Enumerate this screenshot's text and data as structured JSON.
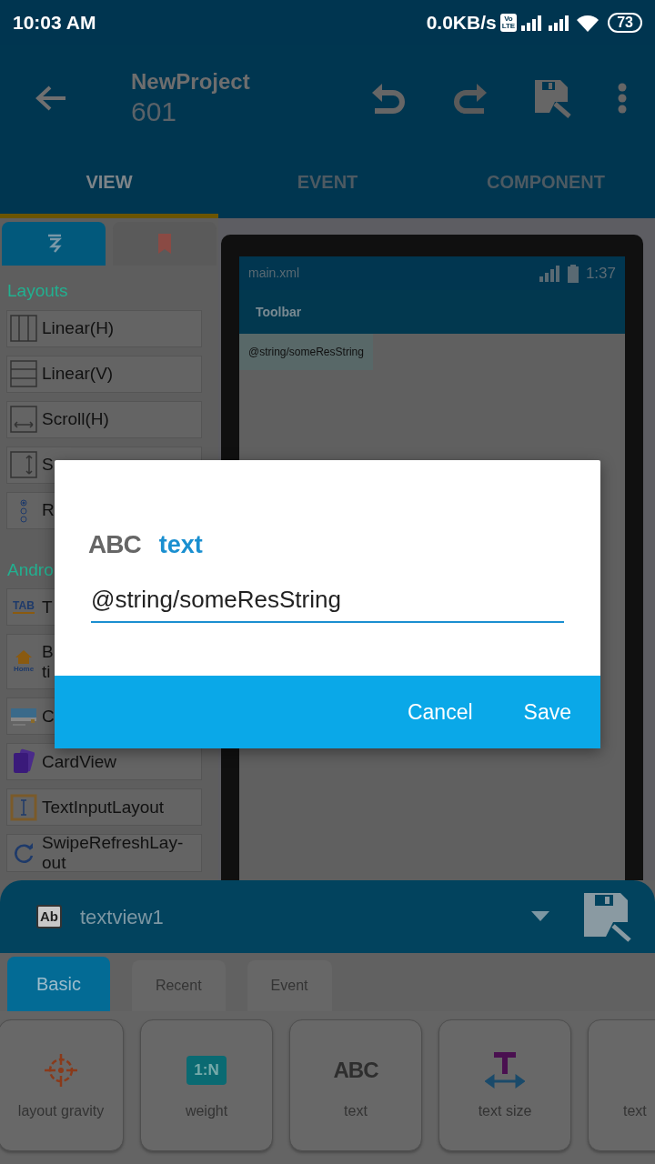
{
  "status_bar": {
    "time": "10:03 AM",
    "net_speed": "0.0KB/s",
    "volte_top": "Vo",
    "volte_bottom": "LTE",
    "battery": "73"
  },
  "app_bar": {
    "title": "NewProject",
    "subtitle": "601"
  },
  "tabs": [
    {
      "label": "VIEW",
      "selected": true
    },
    {
      "label": "EVENT",
      "selected": false
    },
    {
      "label": "COMPONENT",
      "selected": false
    }
  ],
  "palette": {
    "tabs": [
      {
        "selected": true
      },
      {
        "selected": false
      }
    ],
    "sections": [
      {
        "title": "Layouts",
        "items": [
          {
            "label": "Linear(H)"
          },
          {
            "label": "Linear(V)"
          },
          {
            "label": "Scroll(H)"
          },
          {
            "label": "S"
          },
          {
            "label": "R"
          }
        ]
      },
      {
        "title": "Andro",
        "items": [
          {
            "label": "T",
            "icon_text": "TAB"
          },
          {
            "label": "B ti",
            "icon_text": "Home"
          },
          {
            "label": "C"
          },
          {
            "label": "CardView"
          },
          {
            "label": "TextInputLayout"
          },
          {
            "label": "SwipeRefreshLay-out"
          }
        ]
      }
    ]
  },
  "preview": {
    "file": "main.xml",
    "time": "1:37",
    "toolbar": "Toolbar",
    "textview": "@string/someResString"
  },
  "bottom_sheet": {
    "widget_icon": "Ab",
    "widget": "textview1",
    "tabs": [
      {
        "label": "Basic",
        "selected": true
      },
      {
        "label": "Recent",
        "selected": false
      },
      {
        "label": "Event",
        "selected": false
      }
    ],
    "properties": [
      {
        "label": "layout gravity"
      },
      {
        "label": "weight",
        "icon_text": "1:N"
      },
      {
        "label": "text",
        "icon_text": "ABC"
      },
      {
        "label": "text size"
      },
      {
        "label": "text"
      }
    ]
  },
  "dialog": {
    "icon_text": "ABC",
    "title": "text",
    "value": "@string/someResString",
    "buttons": [
      "Cancel",
      "Save"
    ]
  }
}
